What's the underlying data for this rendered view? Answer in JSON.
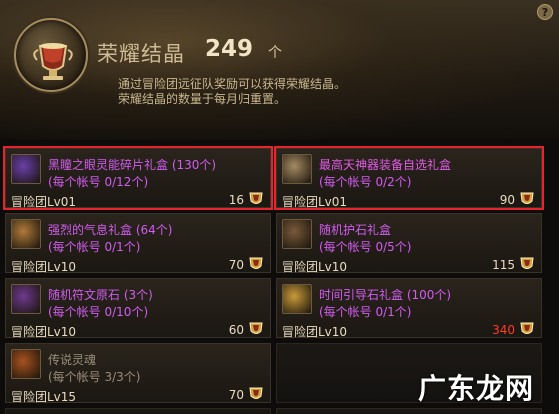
{
  "header": {
    "title": "荣耀结晶",
    "count": "249",
    "unit": "个",
    "desc_line1": "通过冒险团远征队奖励可以获得荣耀结晶。",
    "desc_line2": "荣耀结晶的数量于每月归重置。",
    "help": "?"
  },
  "items": [
    {
      "name": "黑瞳之眼灵能碎片礼盒 (130个)",
      "limit": "(每个帐号 0/12个)",
      "req": "冒险团Lv01",
      "price": "16",
      "name_color": "#d25cf0",
      "limit_color": "#d25cf0",
      "icon": "dark-eye-box-icon",
      "icon_color": "#6a3fa8",
      "highlight": true,
      "price_red": false
    },
    {
      "name": "最高天神器装备自选礼盒",
      "limit": "(每个帐号 0/2个)",
      "req": "冒险团Lv01",
      "price": "90",
      "name_color": "#e25ce8",
      "limit_color": "#d25cf0",
      "icon": "celestial-chest-icon",
      "icon_color": "#a58a62",
      "highlight": true,
      "price_red": false
    },
    {
      "name": "强烈的气息礼盒 (64个)",
      "limit": "(每个帐号 0/1个)",
      "req": "冒险团Lv10",
      "price": "70",
      "name_color": "#d25cf0",
      "limit_color": "#d25cf0",
      "icon": "aura-box-icon",
      "icon_color": "#b07a3a",
      "highlight": false,
      "price_red": false
    },
    {
      "name": "随机护石礼盒",
      "limit": "(每个帐号 0/5个)",
      "req": "冒险团Lv10",
      "price": "115",
      "name_color": "#d25cf0",
      "limit_color": "#d25cf0",
      "icon": "amulet-chest-icon",
      "icon_color": "#7a5a3a",
      "highlight": false,
      "price_red": false
    },
    {
      "name": "随机符文原石 (3个)",
      "limit": "(每个帐号 0/10个)",
      "req": "冒险团Lv10",
      "price": "60",
      "name_color": "#d25cf0",
      "limit_color": "#d25cf0",
      "icon": "rune-stone-icon",
      "icon_color": "#6d3a8c",
      "highlight": false,
      "price_red": false
    },
    {
      "name": "时间引导石礼盒 (100个)",
      "limit": "(每个帐号 0/1个)",
      "req": "冒险团Lv10",
      "price": "340",
      "name_color": "#d25cf0",
      "limit_color": "#d25cf0",
      "icon": "time-stone-box-icon",
      "icon_color": "#c99a3a",
      "highlight": false,
      "price_red": true
    },
    {
      "name": "传说灵魂",
      "limit": "(每个帐号 3/3个)",
      "req": "冒险团Lv15",
      "price": "70",
      "name_color": "#9a8d78",
      "limit_color": "#9a8d78",
      "icon": "legendary-soul-icon",
      "icon_color": "#a8521e",
      "highlight": false,
      "price_red": false
    }
  ],
  "watermark": "广东龙网"
}
